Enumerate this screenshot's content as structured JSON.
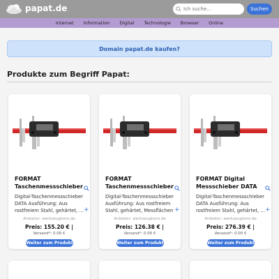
{
  "header": {
    "logo_text": "papat.de",
    "search_placeholder": "Ich suche...",
    "search_button": "Suchen",
    "colors": {
      "bar": "#9b9b9b",
      "accent": "#3b73d9"
    }
  },
  "nav": {
    "items": [
      "Internet",
      "Information",
      "Digital",
      "Technologie",
      "Browser",
      "Online"
    ],
    "color": "#b49bd2"
  },
  "banner": {
    "text": "Domain papat.de kaufen?"
  },
  "section": {
    "title": "Produkte zum Begriff Papat:"
  },
  "products": [
    {
      "title_line1": "FORMAT",
      "title_line2": "Taschenmessschieber",
      "desc_line1": "Digital-Taschenmessschieber",
      "desc_line2": "DATA Ausführung: Aus",
      "desc_line3": "rostfreiem Stahl, gehärtet, Messflächen",
      "vendor": "Anbieter: werkzeughero.de",
      "price": "Preis: 155.20 € |",
      "shipping": "Versand*: 0.00 €",
      "button": "Weiter zum Produkt"
    },
    {
      "title_line1": "FORMAT",
      "title_line2": "Taschenmessschieber",
      "desc_line1": "Digital-Taschenmessschieber",
      "desc_line2": "Ausführung: Aus rostfreiem",
      "desc_line3": "Stahl, gehärtet, Messflächen",
      "vendor": "Anbieter: werkzeughero.de",
      "price": "Preis: 126.38 € |",
      "shipping": "Versand*: 0.00 €",
      "button": "Weiter zum Produkt"
    },
    {
      "title_line1": "FORMAT Digital",
      "title_line2": "Messschieber DATA",
      "desc_line1": "Digital-Taschenmessschieber",
      "desc_line2": "DATA Ausführung: Aus",
      "desc_line3": "rostfreiem Stahl, gehärtet, Messflächen",
      "vendor": "Anbieter: werkzeughero.de",
      "price": "Preis: 276.39 € |",
      "shipping": "Versand*: 0.00 €",
      "button": "Weiter zum Produkt"
    }
  ]
}
